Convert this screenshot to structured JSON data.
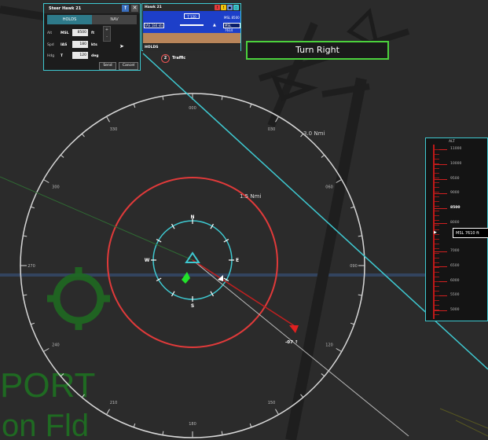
{
  "steer_panel": {
    "title": "Steer Hawk 21",
    "tabs": [
      "HOLDS",
      "NAV"
    ],
    "rows": [
      {
        "label": "Alt",
        "mode": "MSL",
        "value": "8500",
        "unit": "ft"
      },
      {
        "label": "Spd",
        "mode": "IAS",
        "value": "180",
        "unit": "kts"
      },
      {
        "label": "Hdg",
        "mode": "T",
        "value": "120",
        "unit": "deg"
      }
    ],
    "stepper_up": "+",
    "stepper_down": "-",
    "send_label": "Send",
    "cancel_label": "Cancel"
  },
  "hawk_panel": {
    "title": "Hawk 21",
    "heading": "T 120",
    "speed": "IAS 184 kts",
    "alt_target": "MSL 8500",
    "alt_current": "MSL 7614",
    "holds_label": "HOLDS",
    "sky_color": "#1d3fc9",
    "ground_color": "#b9855a"
  },
  "traffic": {
    "count": "2",
    "label": "Traffic"
  },
  "banner": {
    "text": "Turn Right",
    "border_color": "#4bd13c"
  },
  "altitude_tape": {
    "title": "ALT",
    "ticks": [
      "11000",
      "10000",
      "9500",
      "9000",
      "8500",
      "8000",
      "7000",
      "6500",
      "6000",
      "5500",
      "5000"
    ],
    "current": "MSL 7610 ft"
  },
  "compass": {
    "outer_bearings": [
      "300",
      "000",
      "030",
      "060",
      "090",
      "120",
      "150",
      "180",
      "210",
      "240",
      "270",
      "300"
    ],
    "range_outer": "3.0 Nmi",
    "range_mid": "1.5 Nmi",
    "inner_cardinals": [
      "N",
      "E",
      "S",
      "W"
    ],
    "contact_label": "-07 ↑"
  },
  "map": {
    "lower_text_1": "PORT",
    "lower_text_2": "on Fld"
  }
}
